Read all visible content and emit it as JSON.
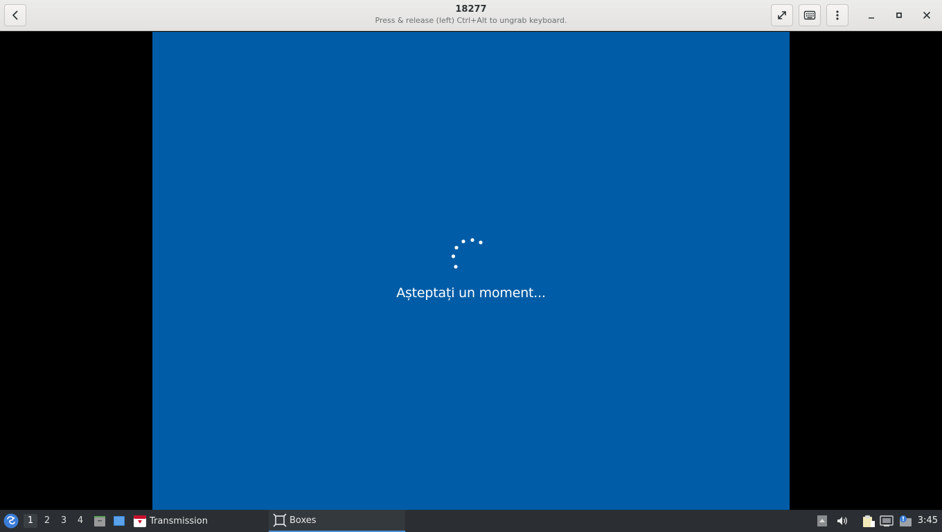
{
  "window": {
    "title": "18277",
    "subtitle": "Press & release (left) Ctrl+Alt to ungrab keyboard."
  },
  "vm": {
    "message": "Așteptați un moment...",
    "background": "#005ca6"
  },
  "taskbar": {
    "workspaces": [
      "1",
      "2",
      "3",
      "4"
    ],
    "active_workspace": "1",
    "tasks": [
      {
        "label": "Transmission",
        "icon": "transmission-icon"
      },
      {
        "label": "Boxes",
        "icon": "boxes-icon"
      }
    ],
    "clock": "3:45"
  },
  "colors": {
    "accent": "#4a90d9",
    "taskbar": "#2b2f33",
    "headerbar": "#e8e7e5"
  }
}
